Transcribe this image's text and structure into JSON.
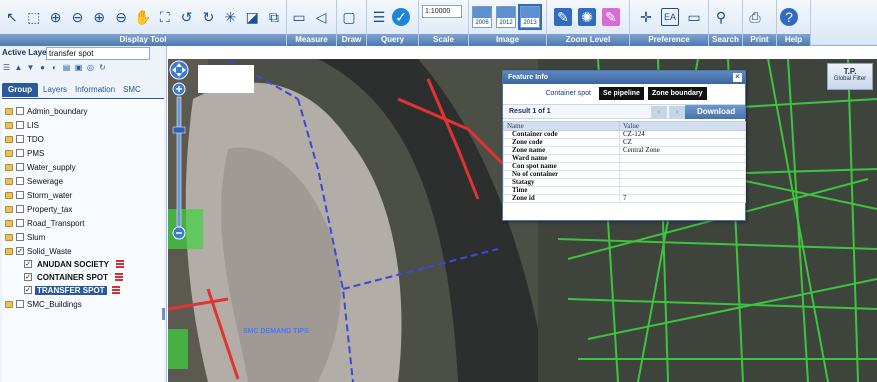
{
  "toolbar": {
    "groups": [
      {
        "label": "Display Tool",
        "icons": [
          "select-arrow-icon",
          "select-box-icon",
          "zoom-in-icon",
          "zoom-out-icon",
          "zoom-window-icon",
          "zoom-out-window-icon",
          "pan-hand-icon",
          "full-extent-icon",
          "previous-extent-icon",
          "next-extent-icon",
          "refresh-icon",
          "identify-icon",
          "select-feature-icon"
        ]
      },
      {
        "label": "Measure",
        "icons": [
          "ruler-icon",
          "area-measure-icon"
        ]
      },
      {
        "label": "Draw",
        "icons": [
          "draw-rectangle-icon"
        ]
      },
      {
        "label": "Query",
        "icons": [
          "query-list-icon",
          "query-check-icon"
        ]
      },
      {
        "label": "Scale",
        "scale_value": "1:10000"
      },
      {
        "label": "Image",
        "years": [
          "2006",
          "2012",
          "2013"
        ]
      },
      {
        "label": "Zoom Level",
        "icons": [
          "zoom-level-1-icon",
          "zoom-level-2-icon",
          "zoom-level-3-icon"
        ]
      },
      {
        "label": "Preference",
        "icons": [
          "crosshair-icon",
          "label-ea-icon",
          "monitor-icon"
        ]
      },
      {
        "label": "Search",
        "icons": [
          "binoculars-icon"
        ]
      },
      {
        "label": "Print",
        "icons": [
          "printer-icon"
        ]
      },
      {
        "label": "Help",
        "icons": [
          "help-icon"
        ]
      }
    ]
  },
  "left_panel": {
    "active_layer_label": "Active Layer :",
    "active_layer_value": "transfer spot",
    "tabs": [
      "Group",
      "Layers",
      "Information",
      "SMC Explorer"
    ],
    "tree": [
      {
        "label": "Admin_boundary",
        "checked": false
      },
      {
        "label": "LIS",
        "checked": false
      },
      {
        "label": "TDO",
        "checked": false
      },
      {
        "label": "PMS",
        "checked": false
      },
      {
        "label": "Water_supply",
        "checked": false
      },
      {
        "label": "Sewerage",
        "checked": false
      },
      {
        "label": "Storm_water",
        "checked": false
      },
      {
        "label": "Property_tax",
        "checked": false
      },
      {
        "label": "Road_Transport",
        "checked": false
      },
      {
        "label": "Slum",
        "checked": false
      },
      {
        "label": "Solid_Waste",
        "checked": true,
        "children": [
          {
            "label": "ANUDAN SOCIETY",
            "checked": true
          },
          {
            "label": "CONTAINER SPOT",
            "checked": true
          },
          {
            "label": "TRANSFER SPOT",
            "checked": true,
            "highlighted": true
          }
        ]
      },
      {
        "label": "SMC_Buildings",
        "checked": false
      }
    ]
  },
  "map": {
    "global_filter": {
      "title": "T.P.",
      "subtitle": "Global Filter"
    },
    "labels": [
      "SMC DEMAND TIPS"
    ]
  },
  "feature_info": {
    "title": "Feature Info",
    "close": "×",
    "tabs": [
      "Container spot",
      "Se pipeline",
      "Zone boundary"
    ],
    "result_text": "Result 1 of 1",
    "prev": "‹",
    "next": "›",
    "download": "Download",
    "columns": [
      "Name",
      "Value"
    ],
    "rows": [
      {
        "name": "Container code",
        "value": "CZ-124"
      },
      {
        "name": "Zone code",
        "value": "CZ"
      },
      {
        "name": "Zone name",
        "value": "Central Zone"
      },
      {
        "name": "Ward name",
        "value": ""
      },
      {
        "name": "Con spot name",
        "value": ""
      },
      {
        "name": "No of container",
        "value": ""
      },
      {
        "name": "Statagy",
        "value": ""
      },
      {
        "name": "Time",
        "value": ""
      },
      {
        "name": "Zone id",
        "value": "7"
      }
    ]
  }
}
